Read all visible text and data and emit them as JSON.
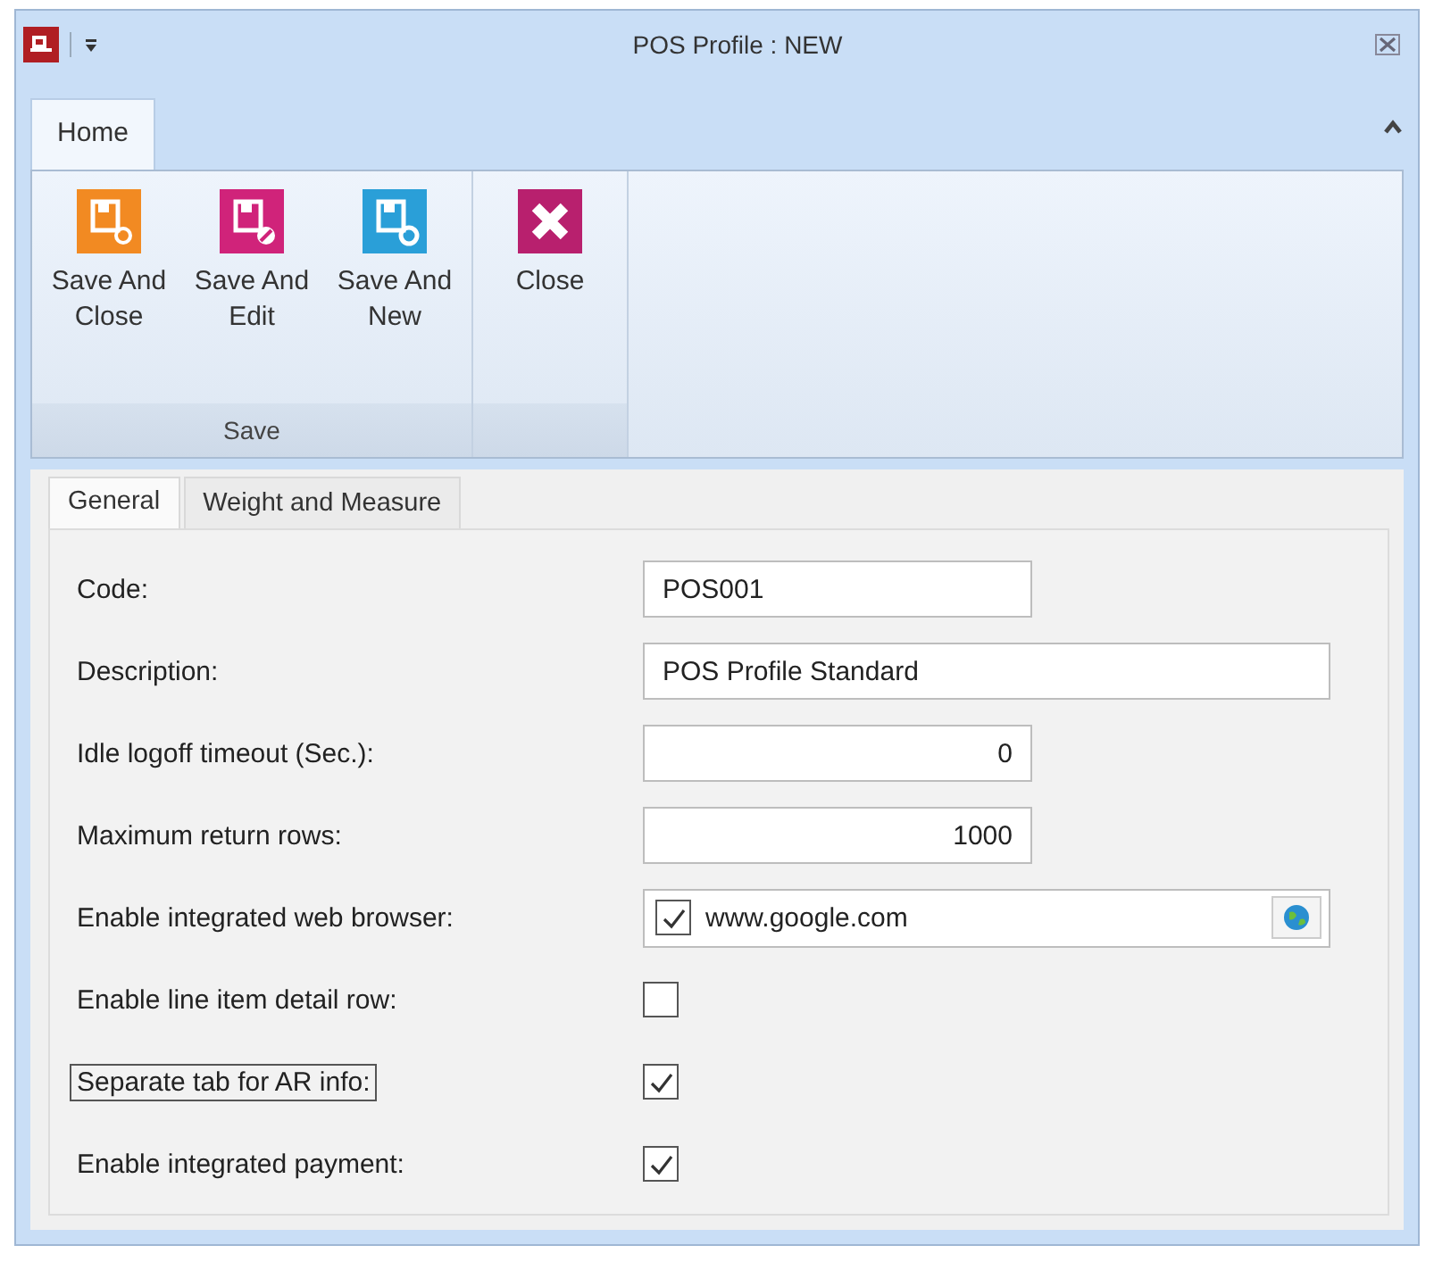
{
  "window": {
    "title": "POS Profile : NEW"
  },
  "ribbon": {
    "tabs": [
      {
        "label": "Home",
        "selected": true
      }
    ],
    "groups": [
      {
        "label": "Save",
        "buttons": [
          {
            "label": "Save And Close",
            "kind": "save-close",
            "color": "#f28a22"
          },
          {
            "label": "Save And Edit",
            "kind": "save-edit",
            "color": "#d0237a"
          },
          {
            "label": "Save And New",
            "kind": "save-new",
            "color": "#2a9fd8"
          }
        ]
      },
      {
        "buttons": [
          {
            "label": "Close",
            "kind": "close",
            "color": "#b8206e"
          }
        ]
      }
    ]
  },
  "form_tabs": [
    {
      "label": "General",
      "selected": true
    },
    {
      "label": "Weight and Measure",
      "selected": false
    }
  ],
  "fields": [
    {
      "kind": "text",
      "label": "Code:",
      "value": "POS001",
      "focused": false
    },
    {
      "kind": "wide-text",
      "label": "Description:",
      "value": "POS Profile Standard",
      "focused": false
    },
    {
      "kind": "number",
      "label": "Idle logoff timeout (Sec.):",
      "value": "0",
      "focused": false
    },
    {
      "kind": "number",
      "label": "Maximum return rows:",
      "value": "1000",
      "focused": false
    },
    {
      "kind": "url-check",
      "label": "Enable integrated web browser:",
      "value": "www.google.com",
      "checked": true,
      "focused": false
    },
    {
      "kind": "check",
      "label": "Enable line item detail row:",
      "checked": false,
      "focused": false
    },
    {
      "kind": "check",
      "label": "Separate tab for AR info:",
      "checked": true,
      "focused": true
    },
    {
      "kind": "check",
      "label": "Enable integrated payment:",
      "checked": true,
      "focused": false
    }
  ]
}
